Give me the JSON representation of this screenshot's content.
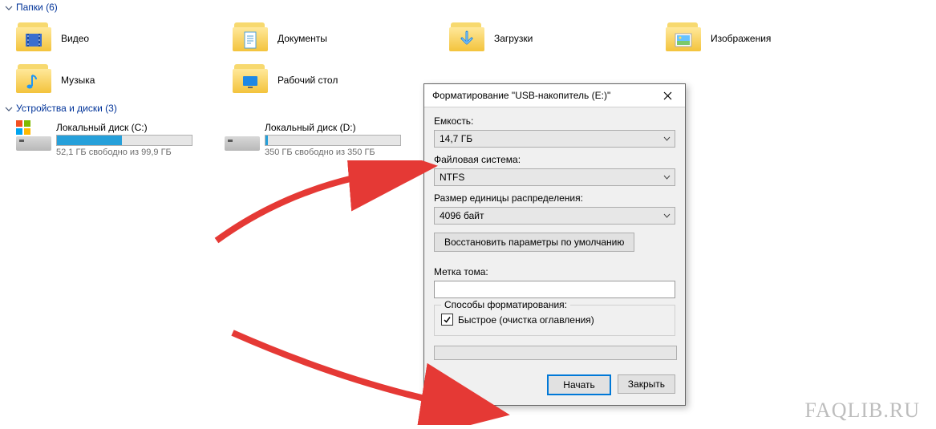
{
  "sections": {
    "folders": {
      "title": "Папки",
      "count": "(6)"
    },
    "drives": {
      "title": "Устройства и диски",
      "count": "(3)"
    }
  },
  "folders": [
    {
      "label": "Видео",
      "icon": "video"
    },
    {
      "label": "Документы",
      "icon": "docs"
    },
    {
      "label": "Загрузки",
      "icon": "downloads"
    },
    {
      "label": "Изображения",
      "icon": "images"
    },
    {
      "label": "Музыка",
      "icon": "music"
    },
    {
      "label": "Рабочий стол",
      "icon": "desktop"
    }
  ],
  "drives": [
    {
      "name": "Локальный диск (C:)",
      "sub": "52,1 ГБ свободно из 99,9 ГБ",
      "fill_pct": 48,
      "os": true
    },
    {
      "name": "Локальный диск (D:)",
      "sub": "350 ГБ свободно из 350 ГБ",
      "fill_pct": 2,
      "os": false
    }
  ],
  "dialog": {
    "title": "Форматирование \"USB-накопитель (E:)\"",
    "labels": {
      "capacity": "Емкость:",
      "filesystem": "Файловая система:",
      "allocation": "Размер единицы распределения:",
      "restore": "Восстановить параметры по умолчанию",
      "volume": "Метка тома:",
      "methods": "Способы форматирования:",
      "quick": "Быстрое (очистка оглавления)"
    },
    "values": {
      "capacity": "14,7 ГБ",
      "filesystem": "NTFS",
      "allocation": "4096 байт",
      "volume": ""
    },
    "quick_checked": true,
    "buttons": {
      "start": "Начать",
      "close": "Закрыть"
    }
  },
  "watermark": "FAQLIB.RU"
}
